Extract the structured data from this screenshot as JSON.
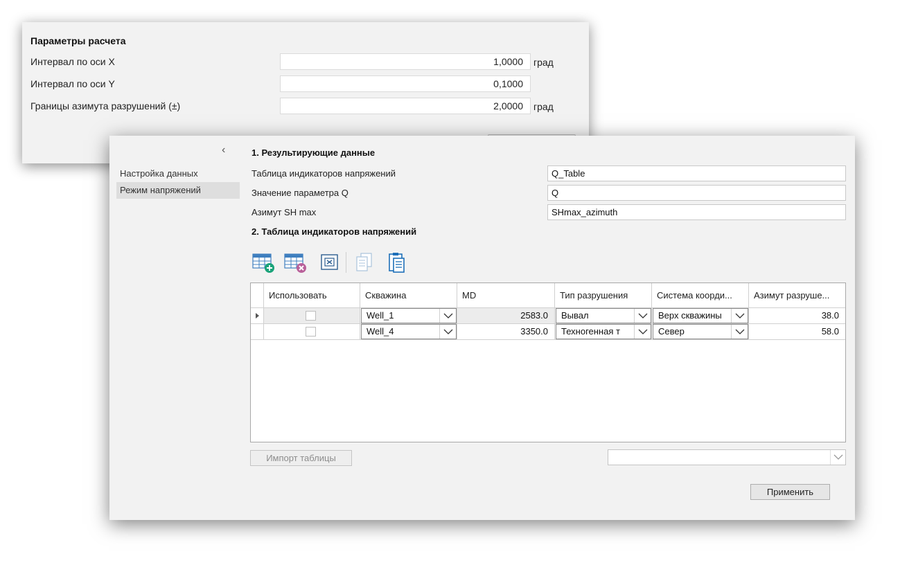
{
  "back_window": {
    "title": "Параметры расчета",
    "rows": [
      {
        "label": "Интервал по оси X",
        "value": "1,0000",
        "unit": "град"
      },
      {
        "label": "Интервал по оси Y",
        "value": "0,1000",
        "unit": ""
      },
      {
        "label": "Границы азимута разрушений (±)",
        "value": "2,0000",
        "unit": "град"
      }
    ]
  },
  "sidebar": {
    "collapse_glyph": "‹",
    "items": [
      {
        "label": "Настройка данных",
        "active": false
      },
      {
        "label": "Режим напряжений",
        "active": true
      }
    ]
  },
  "section1": {
    "title": "1. Результирующие данные",
    "fields": [
      {
        "label": "Таблица индикаторов напряжений",
        "value": "Q_Table"
      },
      {
        "label": "Значение параметра Q",
        "value": "Q"
      },
      {
        "label": "Азимут SH max",
        "value": "SHmax_azimuth"
      }
    ]
  },
  "section2": {
    "title": "2. Таблица индикаторов напряжений"
  },
  "toolbar": {
    "icons": [
      "add-row-icon",
      "delete-row-icon",
      "clear-table-icon",
      "copy-icon",
      "paste-icon"
    ]
  },
  "table": {
    "columns": [
      "Использовать",
      "Скважина",
      "MD",
      "Тип разрушения",
      "Система коорди...",
      "Азимут разруше..."
    ],
    "rows": [
      {
        "use": false,
        "well": "Well_1",
        "md": "2583.0",
        "type": "Вывал",
        "coord": "Верх скважины",
        "azimuth": "38.0",
        "current": true
      },
      {
        "use": false,
        "well": "Well_4",
        "md": "3350.0",
        "type": "Техногенная т",
        "coord": "Север",
        "azimuth": "58.0",
        "current": false
      }
    ]
  },
  "import_button_label": "Импорт таблицы",
  "import_select_value": "",
  "apply_button_label": "Применить",
  "colors": {
    "add_badge": "#1aa37a",
    "delete_badge": "#b9609a",
    "grid_icon": "#3f7fbf"
  }
}
